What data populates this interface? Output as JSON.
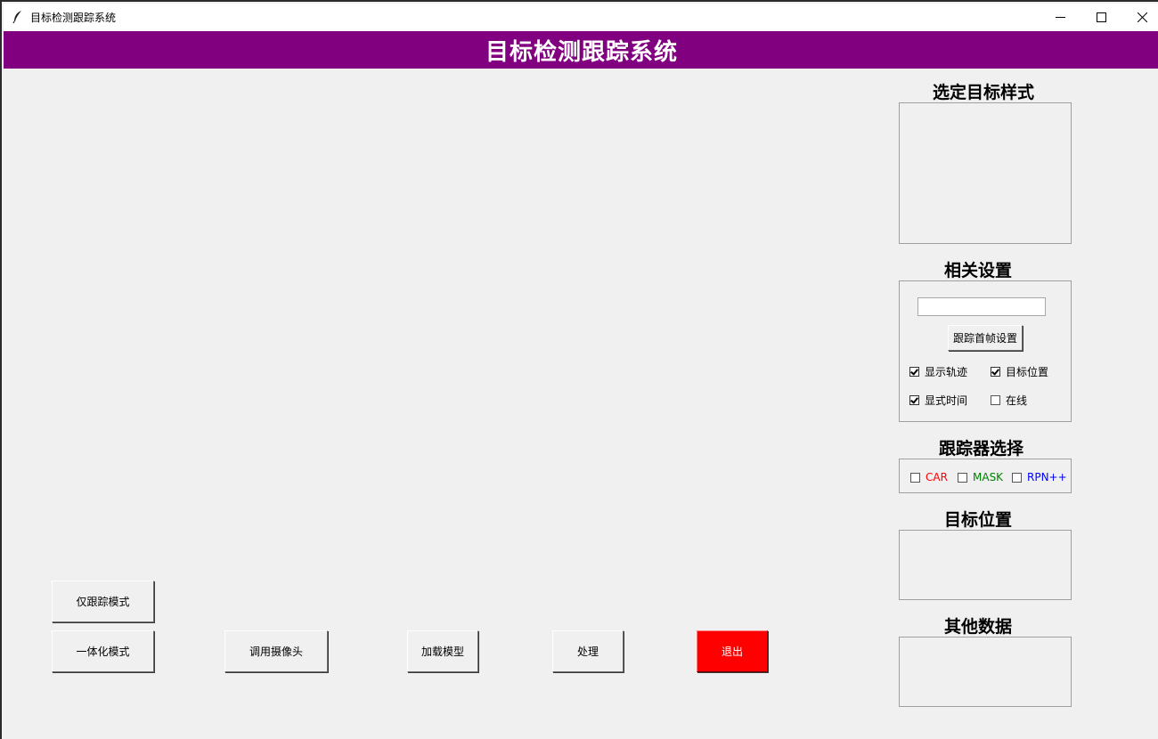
{
  "window": {
    "title": "目标检测跟踪系统",
    "icon": "feather-icon",
    "controls": [
      "minimize-icon",
      "maximize-icon",
      "close-icon"
    ]
  },
  "header": {
    "title": "目标检测跟踪系统",
    "background": "#800080",
    "color": "#ffffff"
  },
  "right_panel": {
    "target_style_title": "选定目标样式",
    "settings_title": "相关设置",
    "settings": {
      "first_frame_input_value": "",
      "first_frame_button": "跟踪首帧设置",
      "checkboxes": [
        {
          "label": "显示轨迹",
          "checked": true
        },
        {
          "label": "目标位置",
          "checked": true
        },
        {
          "label": "显式时间",
          "checked": true
        },
        {
          "label": "在线",
          "checked": false
        }
      ]
    },
    "tracker_title": "跟踪器选择",
    "trackers": [
      {
        "label": "CAR",
        "checked": false,
        "color": "#ff0000"
      },
      {
        "label": "MASK",
        "checked": false,
        "color": "#008000"
      },
      {
        "label": "RPN++",
        "checked": false,
        "color": "#0000ff"
      }
    ],
    "target_position_title": "目标位置",
    "other_data_title": "其他数据"
  },
  "bottom_buttons": {
    "track_only": "仅跟踪模式",
    "integrated": "一体化模式",
    "camera": "调用摄像头",
    "load_model": "加载模型",
    "process": "处理",
    "exit": "退出",
    "exit_color": "#ff0000"
  }
}
